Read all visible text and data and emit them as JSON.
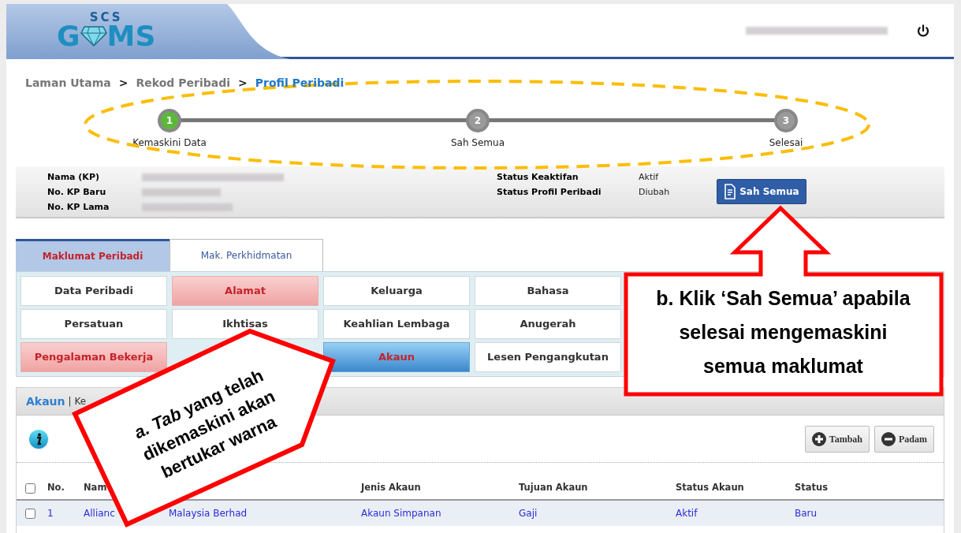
{
  "header": {
    "logo": {
      "top": "SCS",
      "left": "G",
      "right": "MS"
    }
  },
  "breadcrumb": [
    {
      "label": "Laman Utama",
      "current": false,
      "separator": ">"
    },
    {
      "label": "Rekod Peribadi",
      "current": false,
      "separator": ">"
    },
    {
      "label": "Profil Peribadi",
      "current": true
    }
  ],
  "steps": [
    {
      "number": "1",
      "label": "Kemaskini Data",
      "done": true
    },
    {
      "number": "2",
      "label": "Sah Semua",
      "done": false
    },
    {
      "number": "3",
      "label": "Selesai",
      "done": false
    }
  ],
  "profile": {
    "fields": [
      {
        "label": "Nama (KP)"
      },
      {
        "label": "No. KP Baru"
      },
      {
        "label": "No. KP Lama"
      }
    ],
    "status": [
      {
        "label": "Status Keaktifan",
        "value": "Aktif"
      },
      {
        "label": "Status Profil Peribadi",
        "value": "Diubah"
      }
    ],
    "button": "Sah Semua"
  },
  "tabs": [
    {
      "label": "Maklumat Peribadi",
      "selected": true
    },
    {
      "label": "Mak. Perkhidmatan",
      "selected": false
    }
  ],
  "sections": [
    [
      {
        "kind": "tab",
        "label": "Data Peribadi",
        "updated": false,
        "selected": false
      },
      {
        "kind": "tab",
        "label": "Alamat",
        "updated": true,
        "selected": false
      },
      {
        "kind": "tab",
        "label": "Keluarga",
        "updated": false,
        "selected": false
      },
      {
        "kind": "tab",
        "label": "Bahasa",
        "updated": false,
        "selected": false
      }
    ],
    [
      {
        "kind": "tab",
        "label": "Persatuan",
        "updated": false,
        "selected": false
      },
      {
        "kind": "tab",
        "label": "Ikhtisas",
        "updated": false,
        "selected": false
      },
      {
        "kind": "tab",
        "label": "Keahlian Lembaga",
        "updated": false,
        "selected": false
      },
      {
        "kind": "tab",
        "label": "Anugerah",
        "updated": false,
        "selected": false
      }
    ],
    [
      {
        "kind": "tab",
        "label": "Pengalaman Bekerja",
        "updated": true,
        "selected": false
      },
      {
        "kind": "covered"
      },
      {
        "kind": "tab",
        "label": "Akaun",
        "updated": false,
        "selected": true
      },
      {
        "kind": "tab",
        "label": "Lesen Pengangkutan",
        "updated": false,
        "selected": false
      }
    ]
  ],
  "panel": {
    "title": "Akaun",
    "divider": "|",
    "subtitle": "Ke",
    "buttons": [
      {
        "label": "Tambah",
        "kind": "add"
      },
      {
        "label": "Padam",
        "kind": "remove"
      }
    ],
    "header_checked": false,
    "columns": [
      "No.",
      "Nam",
      "Jenis Akaun",
      "Tujuan Akaun",
      "Status Akaun",
      "Status"
    ],
    "rows": [
      {
        "checked": false,
        "no": "1",
        "name_parts": [
          "Allianc",
          "Malaysia Berhad"
        ],
        "type": "Akaun Simpanan",
        "purpose": "Gaji",
        "account_status": "Aktif",
        "status": "Baru"
      }
    ]
  },
  "callouts": [
    {
      "kind": "tag",
      "text": "*a. Tab* yang telah dikemaskini akan bertukar warna"
    },
    {
      "kind": "arrow_box",
      "text": "b. Klik ‘Sah Semua’ apabila selesai mengemaskini semua maklumat"
    }
  ]
}
